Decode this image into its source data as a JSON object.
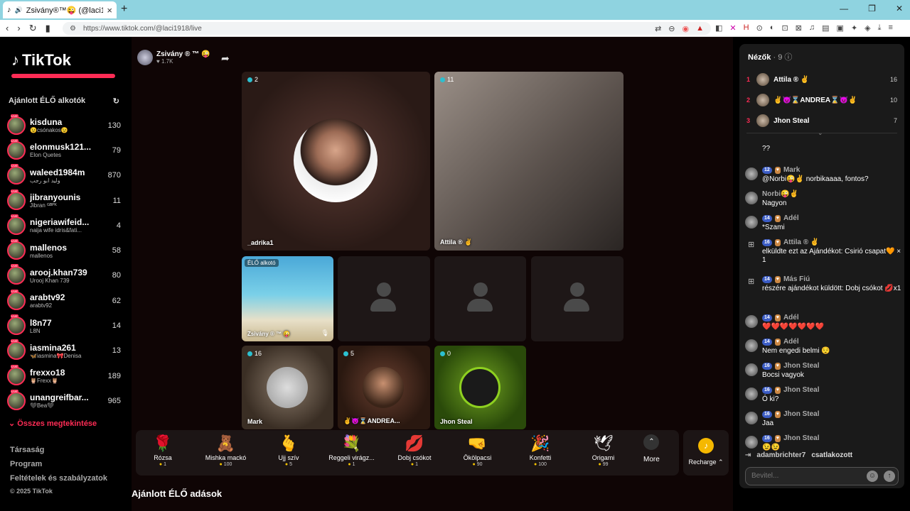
{
  "browser": {
    "tab_title": "Zsivány®™😜 (@laci1918) É...",
    "url": "https://www.tiktok.com/@laci1918/live"
  },
  "sidebar": {
    "logo": "TikTok",
    "recommended_title": "Ajánlott ÉLŐ alkotók",
    "creators": [
      {
        "name": "kisduna",
        "sub": "😉csónakos😉",
        "count": "130"
      },
      {
        "name": "elonmusk121...",
        "sub": "Elon Quetes",
        "count": "79"
      },
      {
        "name": "waleed1984m",
        "sub": "وليد ابو رجب",
        "count": "870"
      },
      {
        "name": "jibranyounis",
        "sub": "Jibran ᴳᴮᴾᴷ",
        "count": "11"
      },
      {
        "name": "nigeriawifeid...",
        "sub": "naija wife idris&fati...",
        "count": "4"
      },
      {
        "name": "mallenos",
        "sub": "mallenos",
        "count": "58"
      },
      {
        "name": "arooj.khan739",
        "sub": "Urooj Khan 739",
        "count": "80"
      },
      {
        "name": "arabtv92",
        "sub": "arabtv92",
        "count": "62"
      },
      {
        "name": "l8n77",
        "sub": "L8N",
        "count": "14"
      },
      {
        "name": "iasmina261",
        "sub": "🦋iasmina🎀Denisa",
        "count": "13"
      },
      {
        "name": "frexxo18",
        "sub": "🦉Frexx🦉",
        "count": "189"
      },
      {
        "name": "unangreifbar...",
        "sub": "🖤Bea🖤",
        "count": "965"
      }
    ],
    "see_all": "Összes megtekintése",
    "links": [
      "Társaság",
      "Program",
      "Feltételek és szabályzatok"
    ],
    "copyright": "© 2025 TikTok"
  },
  "host": {
    "name": "Zsivány ® ™ 😜",
    "likes": "♥ 1.7K"
  },
  "tiles": {
    "t1": {
      "badge": "2",
      "name": "_adrika1"
    },
    "t2": {
      "badge": "11",
      "name": "Attila ® ✌"
    },
    "t3": {
      "badge": "ÉLŐ alkotó",
      "name": "Zsivány ® ™ 😜"
    },
    "t4": {
      "badge": "16",
      "name": "Mark"
    },
    "t5": {
      "badge": "5",
      "name": "✌😈⌛ANDREA..."
    },
    "t6": {
      "badge": "0",
      "name": "Jhon Steal"
    }
  },
  "gifts": [
    {
      "icon": "🌹",
      "label": "Rózsa",
      "price": "1"
    },
    {
      "icon": "🧸",
      "label": "Mishka mackó",
      "price": "100"
    },
    {
      "icon": "🫰",
      "label": "Ujj szív",
      "price": "5"
    },
    {
      "icon": "💐",
      "label": "Reggeli virágz...",
      "price": "1"
    },
    {
      "icon": "💋",
      "label": "Dobj csókot",
      "price": "1"
    },
    {
      "icon": "🤜",
      "label": "Ökölpacsi",
      "price": "90"
    },
    {
      "icon": "🎉",
      "label": "Konfetti",
      "price": "100"
    },
    {
      "icon": "🕊",
      "label": "Origami",
      "price": "99"
    }
  ],
  "more_label": "More",
  "recharge_label": "Recharge",
  "recommended_live": "Ajánlott ÉLŐ adások",
  "chat": {
    "viewers_title": "Nézők",
    "viewers_count": "· 9",
    "viewers": [
      {
        "rank": "1",
        "name": "Attila ® ✌",
        "score": "16"
      },
      {
        "rank": "2",
        "name": "✌😈⌛ANDREA⌛😈✌",
        "score": "10"
      },
      {
        "rank": "3",
        "name": "Jhon Steal",
        "score": "7"
      }
    ],
    "messages": [
      {
        "user": "",
        "level": "",
        "text": "??"
      },
      {
        "user": "Mark",
        "level": "12",
        "text": "@Norbi😜✌ norbikaaaa, fontos?"
      },
      {
        "user": "Norbi😜✌",
        "level": "",
        "text": "Nagyon"
      },
      {
        "user": "Adél",
        "level": "14",
        "text": "*Szami"
      },
      {
        "user": "Attila ® ✌",
        "level": "16",
        "text": "elküldte ezt az Ajándékot: Csirió csapat🧡 × 1"
      },
      {
        "user": "Más Fiú",
        "level": "14",
        "text": "részére ajándékot küldött: Dobj csókot 💋x1"
      },
      {
        "user": "Adél",
        "level": "14",
        "text": "❤️❤️❤️❤️❤️❤️❤️"
      },
      {
        "user": "Adél",
        "level": "14",
        "text": "Nem engedi belmi 😌"
      },
      {
        "user": "Jhon Steal",
        "level": "16",
        "text": "Bocsi vagyok"
      },
      {
        "user": "Jhon Steal",
        "level": "16",
        "text": "Ó ki?"
      },
      {
        "user": "Jhon Steal",
        "level": "16",
        "text": "Jaa"
      },
      {
        "user": "Jhon Steal",
        "level": "16",
        "text": "😉😉"
      }
    ],
    "joined_user": "adambrichter7",
    "joined_text": "csatlakozott",
    "input_placeholder": "Bevitel..."
  }
}
